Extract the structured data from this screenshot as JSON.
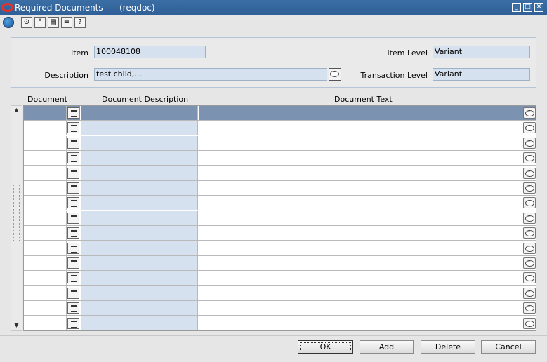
{
  "window": {
    "title": "Required Documents",
    "code": "(reqdoc)",
    "minimize": "_",
    "maximize": "□",
    "close": "✕"
  },
  "toolbar": {
    "icons": [
      "globe-icon",
      "options-icon",
      "spellcheck-icon",
      "calculator-icon",
      "notepad-icon",
      "help-icon"
    ],
    "glyphs": [
      "",
      "⊙",
      "ᴬ",
      "▤",
      "≡",
      "?"
    ]
  },
  "header": {
    "item_label": "Item",
    "item_value": "100048108",
    "description_label": "Description",
    "description_value": "test child,...",
    "item_level_label": "Item Level",
    "item_level_value": "Variant",
    "transaction_level_label": "Transaction Level",
    "transaction_level_value": "Variant"
  },
  "grid": {
    "columns": [
      "Document",
      "Document Description",
      "Document Text"
    ],
    "row_count": 15
  },
  "buttons": {
    "ok": "OK",
    "add": "Add",
    "delete": "Delete",
    "cancel": "Cancel"
  }
}
